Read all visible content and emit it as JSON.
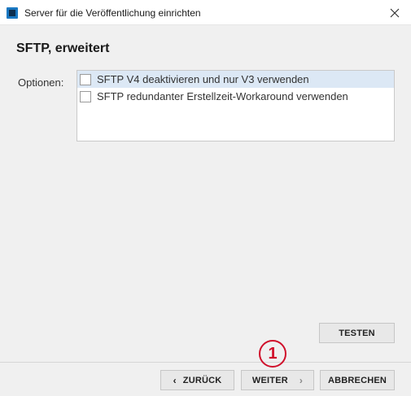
{
  "window": {
    "title": "Server für die Veröffentlichung einrichten"
  },
  "page": {
    "heading": "SFTP, erweitert",
    "options_label": "Optionen:",
    "options": [
      {
        "label": "SFTP V4 deaktivieren und nur V3 verwenden",
        "checked": false,
        "selected": true
      },
      {
        "label": "SFTP redundanter Erstellzeit-Workaround verwenden",
        "checked": false,
        "selected": false
      }
    ],
    "test_button": "TESTEN"
  },
  "footer": {
    "back_button": "ZURÜCK",
    "next_button": "WEITER",
    "cancel_button": "ABBRECHEN"
  },
  "annotation": {
    "marker_label": "1",
    "color": "#d0102b"
  },
  "colors": {
    "accent": "#1a78c2",
    "selection": "#dce8f5",
    "background": "#f0f0f0"
  }
}
